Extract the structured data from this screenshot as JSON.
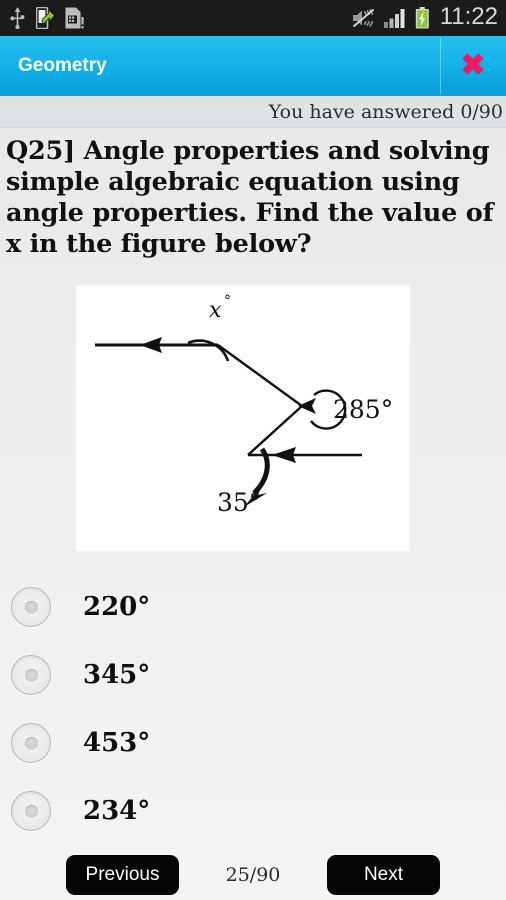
{
  "statusbar": {
    "time": "11:22",
    "icons_left": [
      "usb-icon",
      "phone-transfer-icon",
      "sim-card-icon"
    ],
    "icons_right": [
      "mute-icon",
      "signal-bars-icon",
      "battery-charging-icon"
    ],
    "battery_color": "#8cc63e"
  },
  "titlebar": {
    "title": "Geometry",
    "close_label": "✖",
    "accent_color": "#14b3e8",
    "close_color": "#ec1c63"
  },
  "status": {
    "answered_text": "You have answered 0/90"
  },
  "question": {
    "text": "Q25]   Angle properties and solving simple algebraic equation using angle properties.  Find the value of x in the figure below?"
  },
  "figure": {
    "alt": "Angle diagram with three vertices and two labelled angles",
    "labels": {
      "x": "x",
      "x_degree": "°",
      "middle_angle": "285°",
      "bottom_angle": "35°"
    }
  },
  "options": [
    {
      "id": "opt-a",
      "label": "220°",
      "selected": false
    },
    {
      "id": "opt-b",
      "label": "345°",
      "selected": false
    },
    {
      "id": "opt-c",
      "label": "453°",
      "selected": false
    },
    {
      "id": "opt-d",
      "label": "234°",
      "selected": false
    }
  ],
  "bottombar": {
    "previous_label": "Previous",
    "counter": "25/90",
    "next_label": "Next"
  }
}
